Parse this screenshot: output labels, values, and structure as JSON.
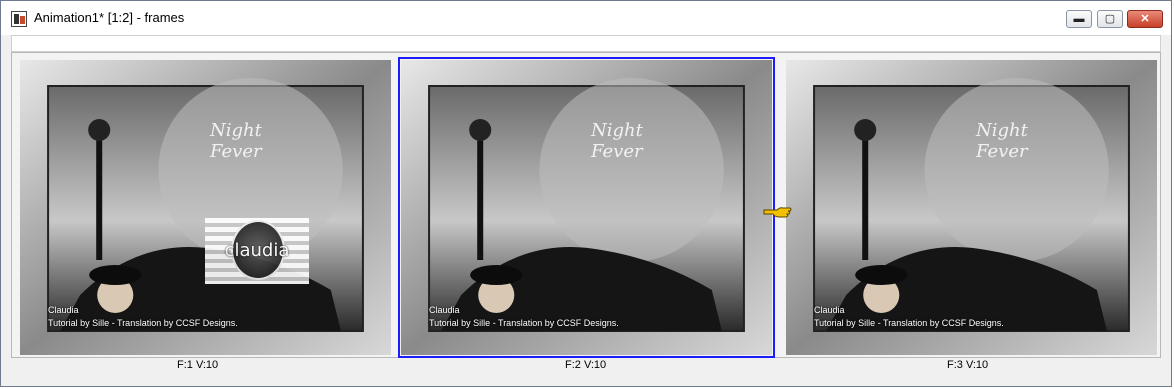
{
  "window": {
    "title": "Animation1* [1:2] - frames",
    "controls": [
      {
        "name": "minimize-button",
        "icon": "minimize-icon",
        "glyph": "▬"
      },
      {
        "name": "maximize-button",
        "icon": "maximize-icon",
        "glyph": "▢"
      },
      {
        "name": "close-button",
        "icon": "close-icon",
        "glyph": "✕"
      }
    ]
  },
  "frames": [
    {
      "caption": "F:1   V:10",
      "selected": false,
      "has_logo": true,
      "logo_text": "claudia",
      "watermark": [
        "Claudia",
        "Tutorial by Sille - Translation by CCSF Designs."
      ]
    },
    {
      "caption": "F:2   V:10",
      "selected": true,
      "has_logo": false,
      "watermark": [
        "Claudia",
        "Tutorial by Sille - Translation by CCSF Designs."
      ]
    },
    {
      "caption": "F:3   V:10",
      "selected": false,
      "has_logo": false,
      "watermark": [
        "Claudia",
        "Tutorial by Sille - Translation by CCSF Designs."
      ]
    }
  ],
  "artwork": {
    "script_line1": "Night",
    "script_line2": "Fever"
  },
  "colors": {
    "selection_outer": "#d21e1e",
    "selection_inner": "#1c1cff",
    "close_button": "#c8402a"
  },
  "pointer": {
    "icon": "hand-pointer-icon"
  }
}
